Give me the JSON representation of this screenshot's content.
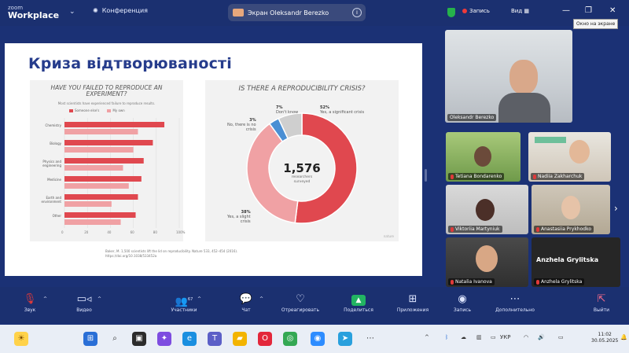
{
  "titlebar": {
    "logo_small": "zoom",
    "logo_big": "Workplace",
    "conference_label": "Конференция",
    "screen_share_label": "Экран Oleksandr Berezko",
    "recording_label": "Запись",
    "view_label": "Вид",
    "tooltip": "Окно на экране"
  },
  "slide": {
    "title": "Криза відтворюваності",
    "left_chart": {
      "title": "HAVE YOU FAILED TO REPRODUCE AN EXPERIMENT?",
      "subtitle": "Most scientists have experienced failure to reproduce results.",
      "legend": [
        "Someone else's",
        "My own"
      ],
      "colors": {
        "someone_else": "#e0484f",
        "my_own": "#f0a1a4"
      }
    },
    "right_chart": {
      "title": "IS THERE A REPRODUCIBILITY CRISIS?",
      "center_number": "1,576",
      "center_sub_1": "researchers",
      "center_sub_2": "surveyed",
      "labels": {
        "significant_pct": "52%",
        "significant_text": "Yes, a significant crisis",
        "dont_know_pct": "7%",
        "dont_know_text": "Don't know",
        "no_pct": "3%",
        "no_text_1": "No, there is no",
        "no_text_2": "crisis",
        "slight_pct": "38%",
        "slight_text_1": "Yes, a slight",
        "slight_text_2": "crisis"
      },
      "brand": "nature"
    },
    "footnote_1": "Baker, M. 1,500 scientists lift the lid on reproducibility. Nature 533, 452–454 (2016).",
    "footnote_2": "https://doi.org/10.1038/533452a"
  },
  "chart_data": [
    {
      "type": "bar",
      "title": "HAVE YOU FAILED TO REPRODUCE AN EXPERIMENT?",
      "categories": [
        "Chemistry",
        "Biology",
        "Physics and engineering",
        "Medicine",
        "Earth and environment",
        "Other"
      ],
      "series": [
        {
          "name": "Someone else's",
          "values": [
            87,
            77,
            69,
            67,
            64,
            62
          ]
        },
        {
          "name": "My own",
          "values": [
            64,
            60,
            51,
            56,
            41,
            49
          ]
        }
      ],
      "x_ticks": [
        "0",
        "20",
        "40",
        "60",
        "80",
        "100%"
      ],
      "xlim": [
        0,
        100
      ]
    },
    {
      "type": "pie",
      "title": "IS THERE A REPRODUCIBILITY CRISIS?",
      "labels": [
        "Yes, a significant crisis",
        "Yes, a slight crisis",
        "No, there is no crisis",
        "Don't know"
      ],
      "values": [
        52,
        38,
        3,
        7
      ],
      "colors": [
        "#e0484f",
        "#f0a1a4",
        "#4a8fd4",
        "#cfcfcf"
      ]
    }
  ],
  "participants": [
    {
      "name": "Oleksandr Berezko",
      "muted": false
    },
    {
      "name": "Tetiana Bondarenko",
      "muted": true
    },
    {
      "name": "Nadiia Zakharchuk",
      "muted": true
    },
    {
      "name": "Viktoriia Martyniuk",
      "muted": true
    },
    {
      "name": "Anastasiia Prykhodko",
      "muted": true
    },
    {
      "name": "Natalia Ivanova",
      "muted": true
    },
    {
      "name": "Anzhela Grylitska",
      "muted": true,
      "big_label": "Anzhela Grylitska"
    }
  ],
  "toolbar": {
    "audio": "Звук",
    "video": "Видео",
    "participants": "Участники",
    "participants_count": "67",
    "chat": "Чат",
    "react": "Отреагировать",
    "share": "Поделиться",
    "apps": "Приложения",
    "record": "Запись",
    "more": "Дополнительно",
    "leave": "Выйти"
  },
  "taskbar": {
    "lang": "УКР",
    "time": "11:02",
    "date": "30.05.2025"
  },
  "colors": {
    "zoom_bg": "#1b3175",
    "accent": "#263c8c",
    "share_green": "#22b462",
    "leave_red": "#e23b3b"
  }
}
